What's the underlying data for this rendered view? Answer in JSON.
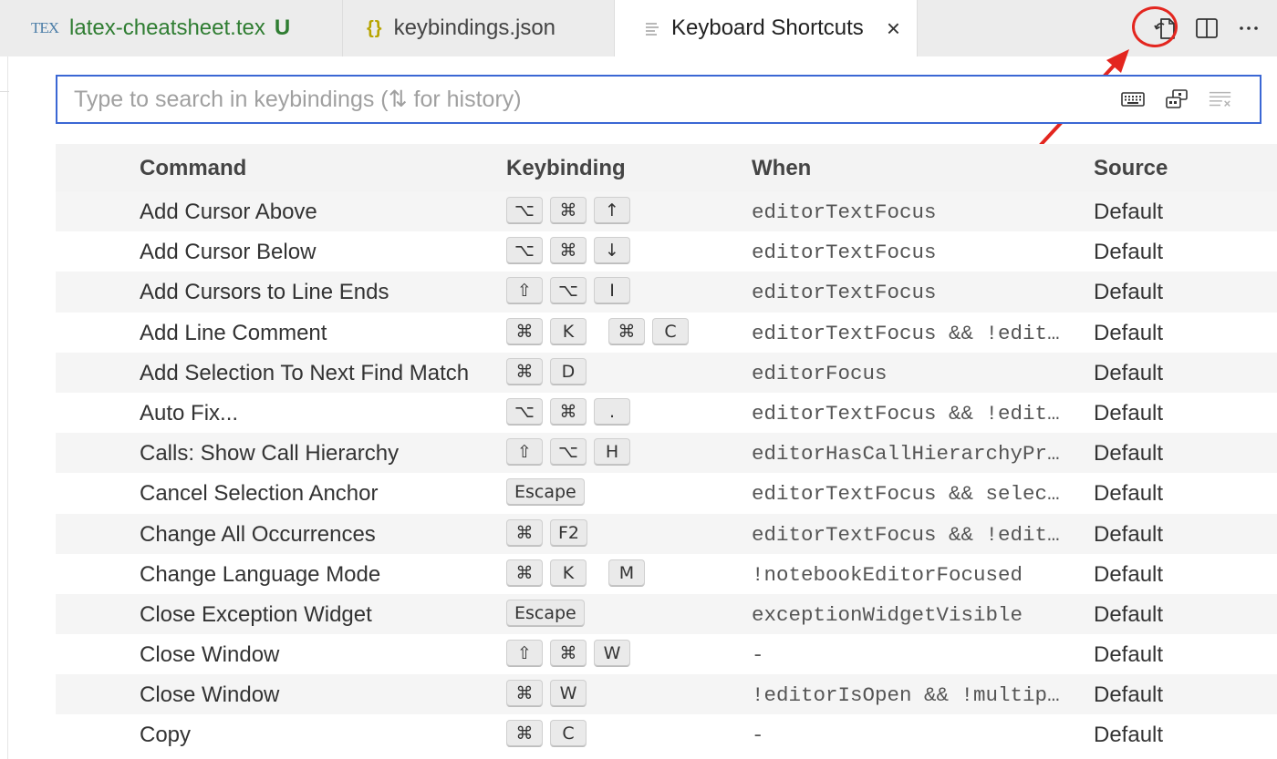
{
  "tabs": [
    {
      "icon": "tex-icon",
      "icon_text": "TEX",
      "label": "latex-cheatsheet.tex",
      "badge": "U"
    },
    {
      "icon": "json-braces-icon",
      "icon_text": "{}",
      "label": "keybindings.json"
    },
    {
      "icon": "lines-icon",
      "label": "Keyboard Shortcuts",
      "close": "×"
    }
  ],
  "search": {
    "placeholder": "Type to search in keybindings (⇅ for history)",
    "value": ""
  },
  "columns": [
    "Command",
    "Keybinding",
    "When",
    "Source"
  ],
  "rows": [
    {
      "command": "Add Cursor Above",
      "keys": [
        [
          "⌥",
          "⌘",
          "↑"
        ]
      ],
      "when": "editorTextFocus",
      "source": "Default"
    },
    {
      "command": "Add Cursor Below",
      "keys": [
        [
          "⌥",
          "⌘",
          "↓"
        ]
      ],
      "when": "editorTextFocus",
      "source": "Default"
    },
    {
      "command": "Add Cursors to Line Ends",
      "keys": [
        [
          "⇧",
          "⌥",
          "I"
        ]
      ],
      "when": "editorTextFocus",
      "source": "Default"
    },
    {
      "command": "Add Line Comment",
      "keys": [
        [
          "⌘",
          "K"
        ],
        [
          "⌘",
          "C"
        ]
      ],
      "when": "editorTextFocus && !editor…",
      "source": "Default"
    },
    {
      "command": "Add Selection To Next Find Match",
      "keys": [
        [
          "⌘",
          "D"
        ]
      ],
      "when": "editorFocus",
      "source": "Default"
    },
    {
      "command": "Auto Fix...",
      "keys": [
        [
          "⌥",
          "⌘",
          "."
        ]
      ],
      "when": "editorTextFocus && !editor…",
      "source": "Default"
    },
    {
      "command": "Calls: Show Call Hierarchy",
      "keys": [
        [
          "⇧",
          "⌥",
          "H"
        ]
      ],
      "when": "editorHasCallHierarchyProv…",
      "source": "Default"
    },
    {
      "command": "Cancel Selection Anchor",
      "keys": [
        [
          "Escape"
        ]
      ],
      "when": "editorTextFocus && selecti…",
      "source": "Default"
    },
    {
      "command": "Change All Occurrences",
      "keys": [
        [
          "⌘",
          "F2"
        ]
      ],
      "when": "editorTextFocus && !editor…",
      "source": "Default"
    },
    {
      "command": "Change Language Mode",
      "keys": [
        [
          "⌘",
          "K"
        ],
        [
          "M"
        ]
      ],
      "when": "!notebookEditorFocused",
      "source": "Default"
    },
    {
      "command": "Close Exception Widget",
      "keys": [
        [
          "Escape"
        ]
      ],
      "when": "exceptionWidgetVisible",
      "source": "Default"
    },
    {
      "command": "Close Window",
      "keys": [
        [
          "⇧",
          "⌘",
          "W"
        ]
      ],
      "when": "-",
      "source": "Default"
    },
    {
      "command": "Close Window",
      "keys": [
        [
          "⌘",
          "W"
        ]
      ],
      "when": "!editorIsOpen && !multiple…",
      "source": "Default"
    },
    {
      "command": "Copy",
      "keys": [
        [
          "⌘",
          "C"
        ]
      ],
      "when": "-",
      "source": "Default"
    }
  ],
  "colors": {
    "highlight_ring": "#e3261f",
    "search_border": "#3b67d4",
    "modified_tab_text": "#2f7d32"
  }
}
